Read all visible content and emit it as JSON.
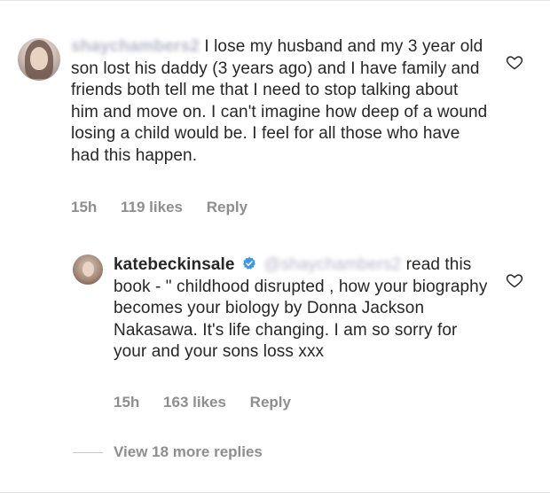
{
  "comments": [
    {
      "username": "shaychambers2",
      "text": "I lose my husband and my 3 year old son lost his daddy (3 years ago) and I have family and friends both tell me that I need to stop talking about him and move on. I can't imagine how deep of a wound losing a child would be. I feel for all those who have had this happen.",
      "time": "15h",
      "likes": "119 likes",
      "reply_label": "Reply",
      "icon": "heart-outline-icon"
    },
    {
      "username": "katebeckinsale",
      "verified_icon": "verified-badge-icon",
      "mention": "@shaychambers2",
      "text": "read this book - \" childhood disrupted , how your biography becomes your biology by Donna Jackson Nakasawa. It's life changing. I am so sorry for your and your sons loss xxx",
      "time": "15h",
      "likes": "163 likes",
      "reply_label": "Reply",
      "icon": "heart-outline-icon"
    }
  ],
  "view_more": "View 18 more replies",
  "colors": {
    "text": "#262626",
    "meta": "#8e8e8e",
    "verified": "#3897f0"
  }
}
